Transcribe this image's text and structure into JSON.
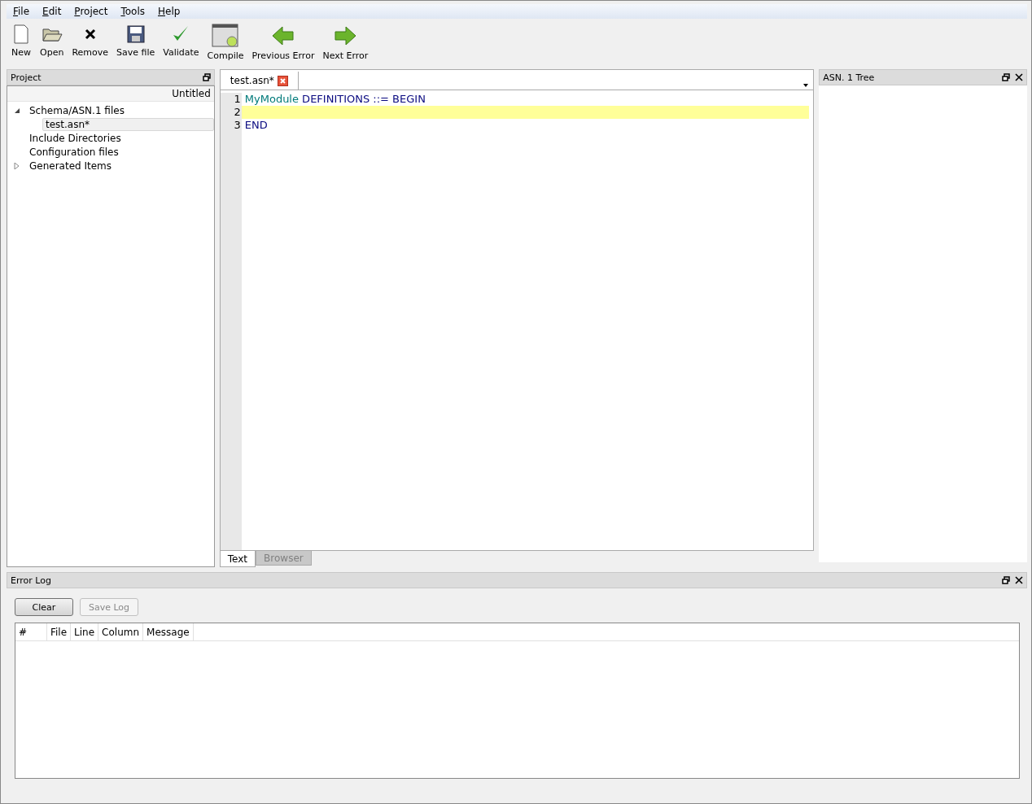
{
  "menu": [
    "File",
    "Edit",
    "Project",
    "Tools",
    "Help"
  ],
  "toolbar": [
    {
      "label": "New",
      "kind": "new"
    },
    {
      "label": "Open",
      "kind": "open"
    },
    {
      "label": "Remove",
      "kind": "remove"
    },
    {
      "label": "Save file",
      "kind": "save"
    },
    {
      "label": "Validate",
      "kind": "validate"
    },
    {
      "label": "Compile",
      "kind": "compile"
    },
    {
      "label": "Previous Error",
      "kind": "prev"
    },
    {
      "label": "Next Error",
      "kind": "next"
    }
  ],
  "project_panel": {
    "title": "Project",
    "header": "Untitled",
    "tree": [
      {
        "label": "Schema/ASN.1 files",
        "expanded": true,
        "selected": false,
        "children": [
          {
            "label": "test.asn*",
            "selected": true
          }
        ]
      },
      {
        "label": "Include Directories",
        "selected": false
      },
      {
        "label": "Configuration files",
        "selected": false
      },
      {
        "label": "Generated Items",
        "expanded": false,
        "selected": false
      }
    ]
  },
  "editor": {
    "tabs": [
      {
        "label": "test.asn*",
        "selected": true
      }
    ],
    "lines": [
      {
        "number": "1",
        "current": false,
        "tokens": [
          {
            "text": "MyModule",
            "kind": "identifier"
          },
          {
            "text": " DEFINITIONS ::= BEGIN",
            "kind": "keyword"
          }
        ]
      },
      {
        "number": "2",
        "current": true
      },
      {
        "number": "3",
        "current": false,
        "tokens": [
          {
            "text": "END",
            "kind": "keyword"
          }
        ]
      }
    ],
    "view_tabs": [
      {
        "label": "Text",
        "selected": true
      },
      {
        "label": "Browser",
        "selected": false
      }
    ]
  },
  "tree_panel": {
    "title": "ASN. 1 Tree"
  },
  "error_log": {
    "title": "Error Log",
    "buttons": [
      {
        "label": "Clear",
        "disabled": false
      },
      {
        "label": "Save Log",
        "disabled": true
      }
    ],
    "columns": [
      "#",
      "File",
      "Line",
      "Column",
      "Message"
    ]
  }
}
